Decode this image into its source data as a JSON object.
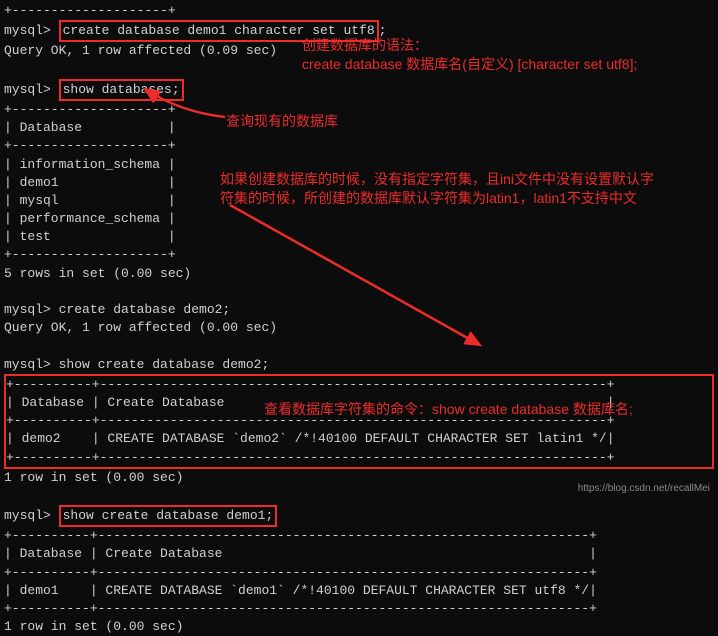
{
  "cmd1": {
    "prompt": "mysql> ",
    "text": "create database demo1 character set utf8",
    "tail": ";"
  },
  "resp1": "Query OK, 1 row affected (0.09 sec)",
  "cmd2": {
    "prompt": "mysql> ",
    "text": "show databases;"
  },
  "tbl1": {
    "border_top": "+--------------------+",
    "header": "| Database           |",
    "border_mid": "+--------------------+",
    "rows": [
      "| information_schema |",
      "| demo1              |",
      "| mysql              |",
      "| performance_schema |",
      "| test               |"
    ],
    "border_bot": "+--------------------+",
    "footer": "5 rows in set (0.00 sec)"
  },
  "cmd3": {
    "prompt": "mysql> ",
    "text": "create database demo2;"
  },
  "resp3": "Query OK, 1 row affected (0.00 sec)",
  "cmd4": {
    "prompt": "mysql> ",
    "text": "show create database demo2;"
  },
  "tbl2": {
    "border_top": "+----------+-----------------------------------------------------------------+",
    "header": "| Database | Create Database                                                 |",
    "border_mid": "+----------+-----------------------------------------------------------------+",
    "row": "| demo2    | CREATE DATABASE `demo2` /*!40100 DEFAULT CHARACTER SET latin1 */|",
    "border_bot": "+----------+-----------------------------------------------------------------+",
    "footer": "1 row in set (0.00 sec)"
  },
  "cmd5": {
    "prompt": "mysql> ",
    "text": "show create database demo1;"
  },
  "tbl3": {
    "border_top": "+----------+---------------------------------------------------------------+",
    "header": "| Database | Create Database                                               |",
    "border_mid": "+----------+---------------------------------------------------------------+",
    "row": "| demo1    | CREATE DATABASE `demo1` /*!40100 DEFAULT CHARACTER SET utf8 */|",
    "border_bot": "+----------+---------------------------------------------------------------+",
    "footer": "1 row in set (0.00 sec)"
  },
  "anno": {
    "a1_l1": "创建数据库的语法：",
    "a1_l2": "create database 数据库名(自定义) [character set utf8];",
    "a2": "查询现有的数据库",
    "a3_l1": "如果创建数据库的时候，没有指定字符集，且ini文件中没有设置默认字",
    "a3_l2": "符集的时候，所创建的数据库默认字符集为latin1，latin1不支持中文",
    "a4": "查看数据库字符集的命令：show create database 数据库名;"
  },
  "watermark": "https://blog.csdn.net/recallMei",
  "colors": {
    "red": "#ec2b2b"
  }
}
